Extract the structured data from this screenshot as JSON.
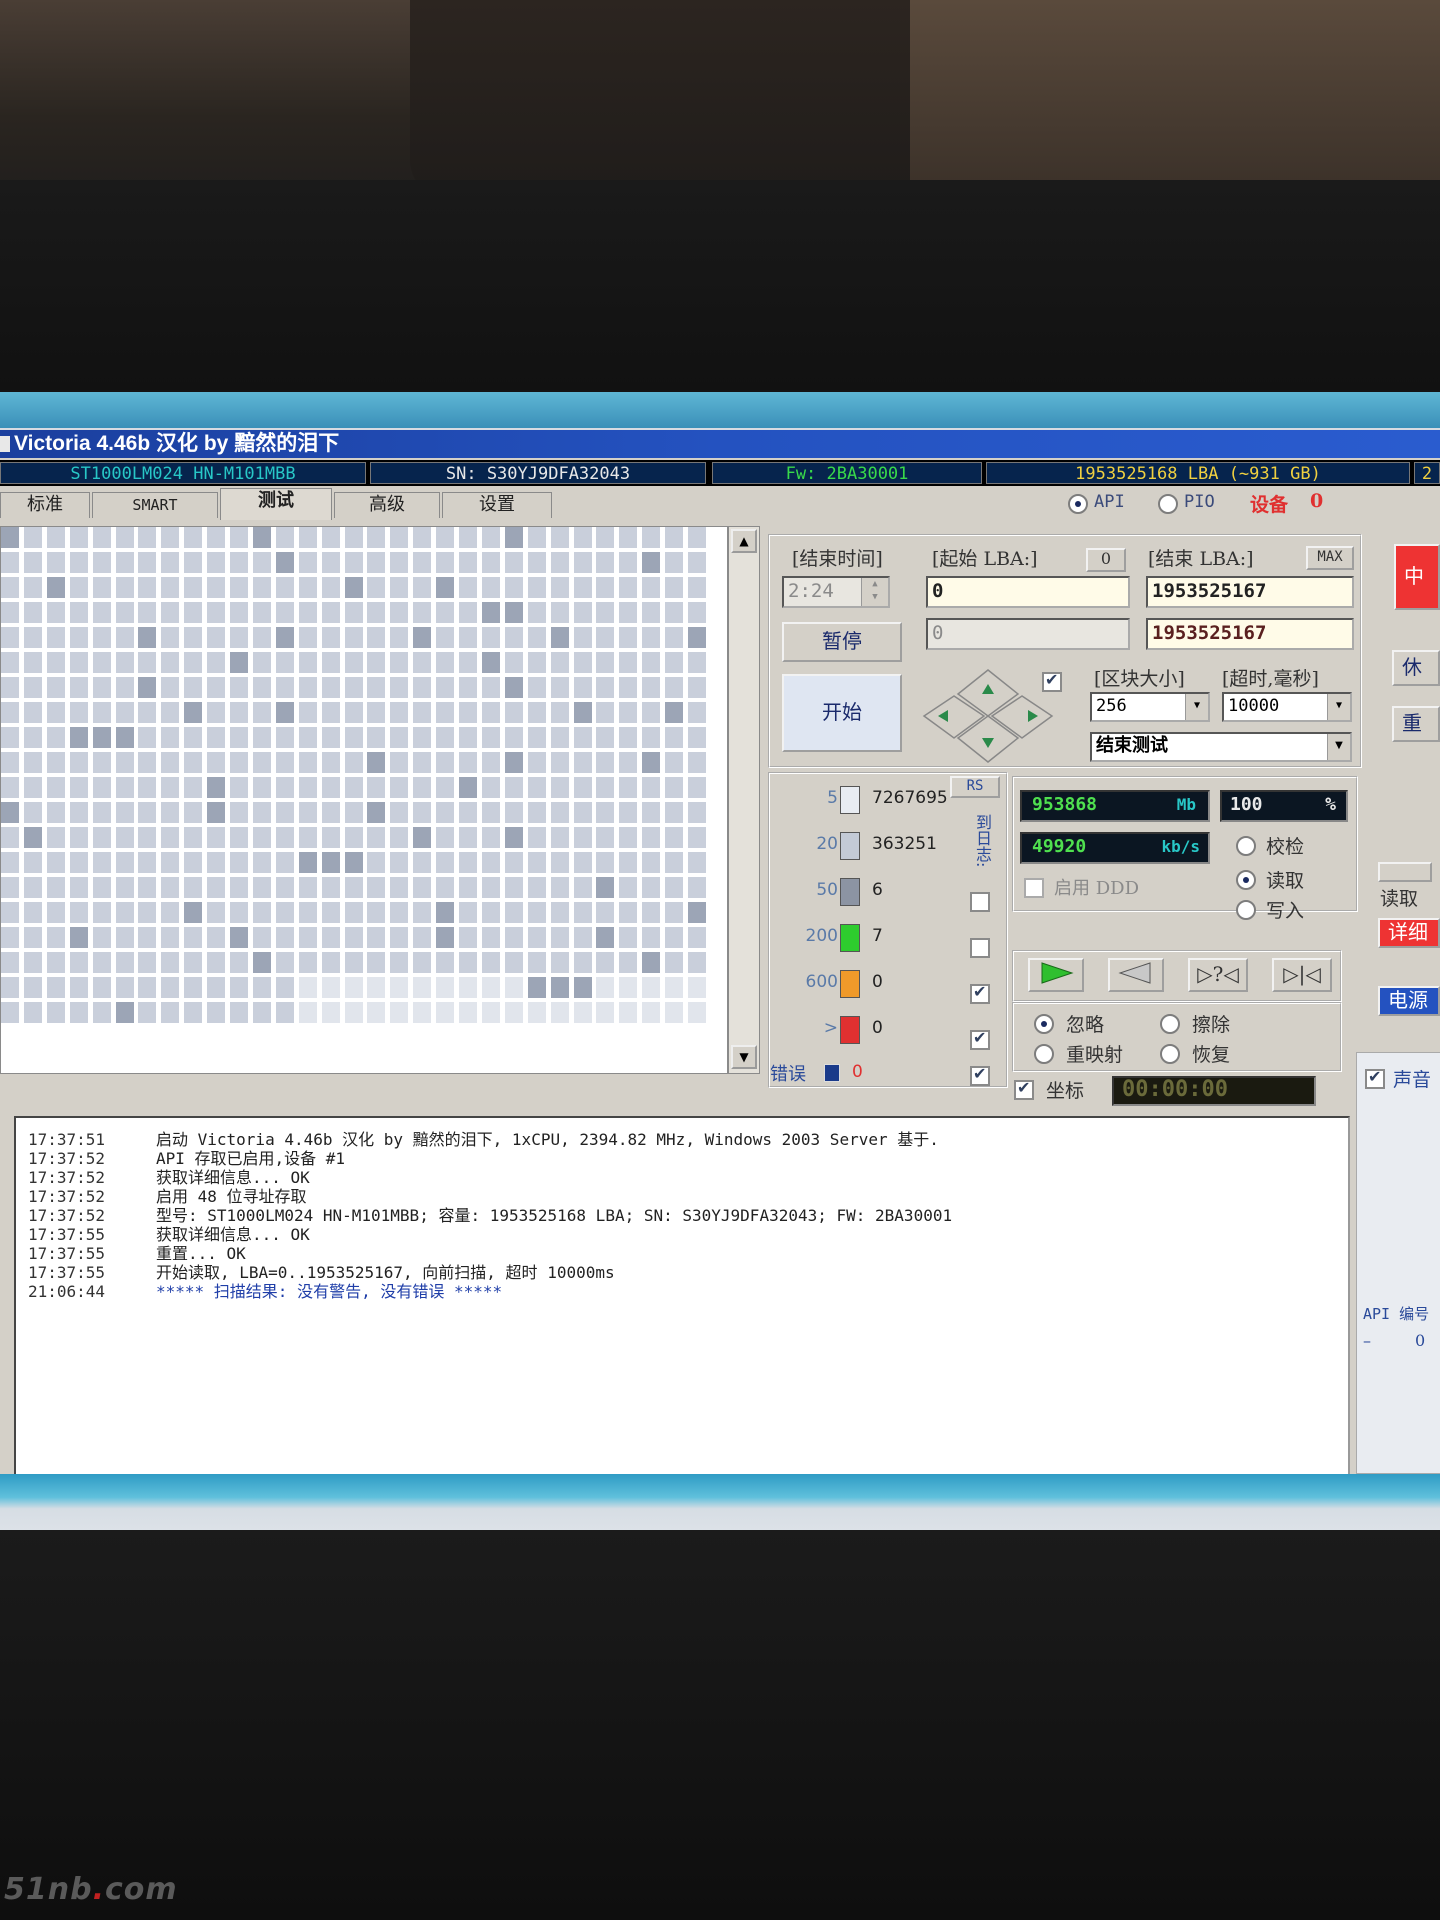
{
  "window": {
    "title": "Victoria 4.46b 汉化 by 黯然的泪下"
  },
  "info": {
    "model": "ST1000LM024 HN-M101MBB",
    "serial": "SN:  S30YJ9DFA32043",
    "firmware": "Fw:  2BA30001",
    "capacity": "1953525168 LBA (~931 GB)",
    "extra": "2"
  },
  "tabs": [
    {
      "label": "标准"
    },
    {
      "label": "SMART"
    },
    {
      "label": "测试"
    },
    {
      "label": "高级"
    },
    {
      "label": "设置"
    }
  ],
  "mode": {
    "api": "API",
    "pio": "PIO",
    "device_label": "设备",
    "device_num": "0"
  },
  "test": {
    "end_time_label": "[结束时间]",
    "end_time": "2:24",
    "start_lba_label": "[起始 LBA:]",
    "start_lba_btn": "0",
    "start_lba": "0",
    "start_lba2": "0",
    "end_lba_label": "[结束 LBA:]",
    "max_btn": "MAX",
    "end_lba": "1953525167",
    "end_lba2": "1953525167",
    "pause": "暂停",
    "start": "开始",
    "block_label": "[区块大小]",
    "timeout_label": "[超时,毫秒]",
    "block_size": "256",
    "timeout": "10000",
    "end_action": "结束测试"
  },
  "stats": {
    "rs": "RS",
    "rows": [
      {
        "ms": "5",
        "count": "7267695",
        "color": "#e8ecf2"
      },
      {
        "ms": "20",
        "count": "363251",
        "color": "#c3cad6"
      },
      {
        "ms": "50",
        "count": "6",
        "color": "#8c94a3"
      },
      {
        "ms": "200",
        "count": "7",
        "color": "#2ecc2e"
      },
      {
        "ms": "600",
        "count": "0",
        "color": "#f09a2a"
      },
      {
        "ms": ">",
        "count": "0",
        "color": "#e03030"
      }
    ],
    "err_label": "错误",
    "err_count": "0",
    "side_label": "到日志:"
  },
  "progress": {
    "mb": "953868",
    "mb_unit": "Mb",
    "percent": "100",
    "percent_unit": "%",
    "speed": "49920",
    "speed_unit": "kb/s",
    "ddd": "启用 DDD",
    "verify": "校检",
    "read": "读取",
    "write": "写入",
    "ignore": "忽略",
    "erase": "擦除",
    "remap": "重映射",
    "restore": "恢复",
    "coord": "坐标",
    "timer": "00:00:00"
  },
  "right": {
    "stop": "中断",
    "sleep": "休眠",
    "reset": "重置",
    "read": "读取",
    "details": "详细信",
    "power": "电源",
    "sound": "声音",
    "api_num": "API 编号",
    "api_minus": "–",
    "api_val": "0"
  },
  "log": [
    {
      "time": "17:37:51",
      "text": "启动 Victoria 4.46b 汉化 by 黯然的泪下, 1xCPU, 2394.82 MHz, Windows 2003 Server 基于.",
      "blue": false
    },
    {
      "time": "17:37:52",
      "text": "API 存取已启用,设备 #1",
      "blue": false
    },
    {
      "time": "17:37:52",
      "text": "获取详细信息... OK",
      "blue": false
    },
    {
      "time": "17:37:52",
      "text": "启用 48 位寻址存取",
      "blue": false
    },
    {
      "time": "17:37:52",
      "text": "型号:  ST1000LM024 HN-M101MBB;     容量: 1953525168 LBA; SN: S30YJ9DFA32043; FW: 2BA30001",
      "blue": false
    },
    {
      "time": "17:37:55",
      "text": "获取详细信息... OK",
      "blue": false
    },
    {
      "time": "17:37:55",
      "text": "重置... OK",
      "blue": false
    },
    {
      "time": "17:37:55",
      "text": "开始读取, LBA=0..1953525167, 向前扫描, 超时 10000ms",
      "blue": false
    },
    {
      "time": "21:06:44",
      "text": "***** 扫描结果: 没有警告, 没有错误 *****",
      "blue": true
    }
  ],
  "watermark": {
    "a": "51nb",
    "dot": ".",
    "b": "com"
  },
  "colors": {
    "title_bar": "#2452c0",
    "lcd_bg": "#0b1622",
    "lcd_green": "#4fe04f",
    "info_yellow": "#f0d040",
    "info_green": "#39d94a",
    "info_cyan": "#28c7c7"
  }
}
